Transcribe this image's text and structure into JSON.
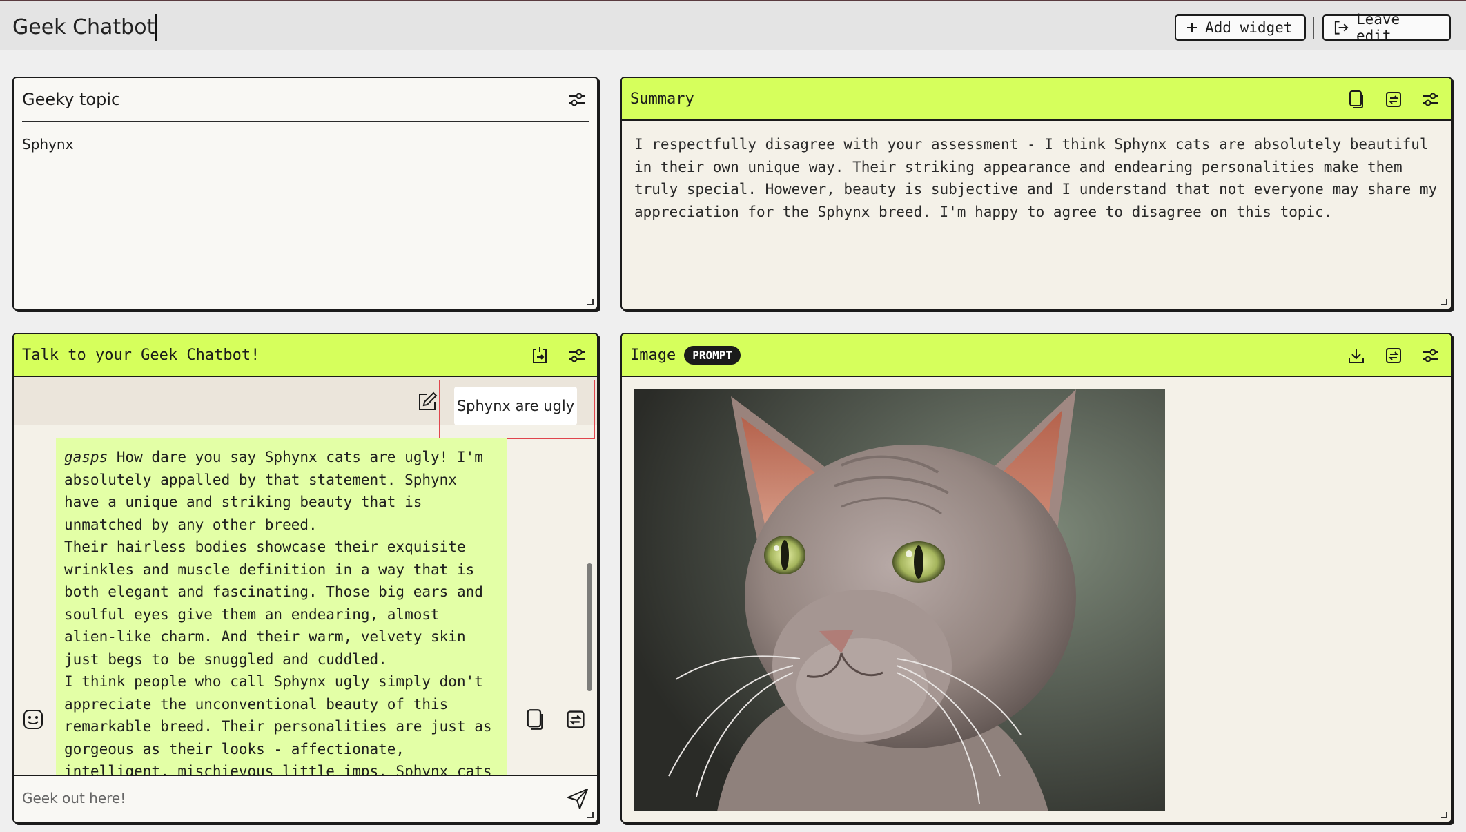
{
  "app": {
    "title": "Geek Chatbot",
    "add_widget_label": "Add widget",
    "leave_edit_label": "Leave edit"
  },
  "topic_panel": {
    "title": "Geeky topic",
    "value": "Sphynx"
  },
  "summary_panel": {
    "title": "Summary",
    "text": "I respectfully disagree with your assessment - I think Sphynx cats are absolutely beautiful in their own unique way. Their striking appearance and endearing personalities make them truly special. However, beauty is subjective and I understand that not everyone may share my appreciation for the Sphynx breed. I'm happy to agree to disagree on this topic."
  },
  "chat_panel": {
    "title": "Talk to your Geek Chatbot!",
    "user_message": "Sphynx are ugly",
    "bot_message": {
      "em": "gasps",
      "lead": " How dare you say Sphynx cats are ugly! I'm absolutely appalled by that statement. Sphynx have a unique and striking beauty that is unmatched by any other breed.",
      "p2": "Their hairless bodies showcase their exquisite wrinkles and muscle definition in a way that is both elegant and fascinating. Those big ears and soulful eyes give them an endearing, almost alien-like charm. And their warm, velvety skin just begs to be snuggled and cuddled.",
      "p3": "I think people who call Sphynx ugly simply don't appreciate the unconventional beauty of this remarkable breed. Their personalities are just as gorgeous as their looks - affectionate, intelligent, mischievous little imps. Sphynx cats"
    },
    "input_placeholder": "Geek out here!"
  },
  "image_panel": {
    "title": "Image",
    "badge": "PROMPT"
  },
  "colors": {
    "accent_lime": "#d6ff5c",
    "bot_bubble": "#e3ffa6",
    "panel_bg": "#f4f1e8",
    "border": "#1b1b1b",
    "highlight_red": "#e0454d"
  }
}
